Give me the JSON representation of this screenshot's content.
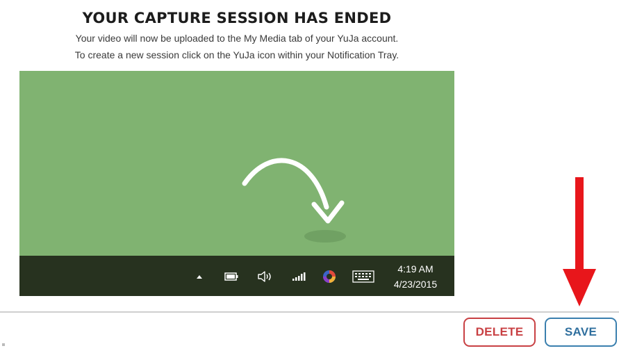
{
  "dialog": {
    "title": "YOUR CAPTURE SESSION HAS ENDED",
    "description_line1": "Your video will now be uploaded to the My Media tab of your YuJa account.",
    "description_line2": "To create a new session click on the YuJa icon within your Notification Tray."
  },
  "preview": {
    "background_color": "#80b371",
    "taskbar_color": "#27321f",
    "tray_icons": [
      "chevron-up-icon",
      "battery-icon",
      "speaker-icon",
      "signal-icon",
      "yuja-icon",
      "keyboard-icon"
    ],
    "time": "4:19 AM",
    "date": "4/23/2015"
  },
  "actions": {
    "delete_label": "DELETE",
    "save_label": "SAVE",
    "delete_color": "#c84043",
    "save_color": "#3a7fae"
  },
  "annotation": {
    "arrow_color": "#e8161b",
    "points_to": "save-button"
  }
}
